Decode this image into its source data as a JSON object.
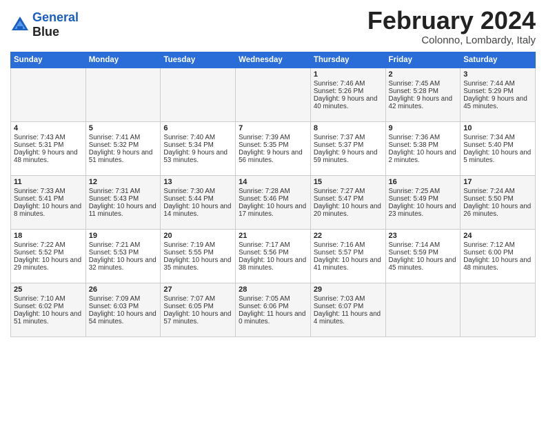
{
  "header": {
    "logo_line1": "General",
    "logo_line2": "Blue",
    "month": "February 2024",
    "location": "Colonno, Lombardy, Italy"
  },
  "weekdays": [
    "Sunday",
    "Monday",
    "Tuesday",
    "Wednesday",
    "Thursday",
    "Friday",
    "Saturday"
  ],
  "weeks": [
    [
      {
        "day": "",
        "sunrise": "",
        "sunset": "",
        "daylight": ""
      },
      {
        "day": "",
        "sunrise": "",
        "sunset": "",
        "daylight": ""
      },
      {
        "day": "",
        "sunrise": "",
        "sunset": "",
        "daylight": ""
      },
      {
        "day": "",
        "sunrise": "",
        "sunset": "",
        "daylight": ""
      },
      {
        "day": "1",
        "sunrise": "Sunrise: 7:46 AM",
        "sunset": "Sunset: 5:26 PM",
        "daylight": "Daylight: 9 hours and 40 minutes."
      },
      {
        "day": "2",
        "sunrise": "Sunrise: 7:45 AM",
        "sunset": "Sunset: 5:28 PM",
        "daylight": "Daylight: 9 hours and 42 minutes."
      },
      {
        "day": "3",
        "sunrise": "Sunrise: 7:44 AM",
        "sunset": "Sunset: 5:29 PM",
        "daylight": "Daylight: 9 hours and 45 minutes."
      }
    ],
    [
      {
        "day": "4",
        "sunrise": "Sunrise: 7:43 AM",
        "sunset": "Sunset: 5:31 PM",
        "daylight": "Daylight: 9 hours and 48 minutes."
      },
      {
        "day": "5",
        "sunrise": "Sunrise: 7:41 AM",
        "sunset": "Sunset: 5:32 PM",
        "daylight": "Daylight: 9 hours and 51 minutes."
      },
      {
        "day": "6",
        "sunrise": "Sunrise: 7:40 AM",
        "sunset": "Sunset: 5:34 PM",
        "daylight": "Daylight: 9 hours and 53 minutes."
      },
      {
        "day": "7",
        "sunrise": "Sunrise: 7:39 AM",
        "sunset": "Sunset: 5:35 PM",
        "daylight": "Daylight: 9 hours and 56 minutes."
      },
      {
        "day": "8",
        "sunrise": "Sunrise: 7:37 AM",
        "sunset": "Sunset: 5:37 PM",
        "daylight": "Daylight: 9 hours and 59 minutes."
      },
      {
        "day": "9",
        "sunrise": "Sunrise: 7:36 AM",
        "sunset": "Sunset: 5:38 PM",
        "daylight": "Daylight: 10 hours and 2 minutes."
      },
      {
        "day": "10",
        "sunrise": "Sunrise: 7:34 AM",
        "sunset": "Sunset: 5:40 PM",
        "daylight": "Daylight: 10 hours and 5 minutes."
      }
    ],
    [
      {
        "day": "11",
        "sunrise": "Sunrise: 7:33 AM",
        "sunset": "Sunset: 5:41 PM",
        "daylight": "Daylight: 10 hours and 8 minutes."
      },
      {
        "day": "12",
        "sunrise": "Sunrise: 7:31 AM",
        "sunset": "Sunset: 5:43 PM",
        "daylight": "Daylight: 10 hours and 11 minutes."
      },
      {
        "day": "13",
        "sunrise": "Sunrise: 7:30 AM",
        "sunset": "Sunset: 5:44 PM",
        "daylight": "Daylight: 10 hours and 14 minutes."
      },
      {
        "day": "14",
        "sunrise": "Sunrise: 7:28 AM",
        "sunset": "Sunset: 5:46 PM",
        "daylight": "Daylight: 10 hours and 17 minutes."
      },
      {
        "day": "15",
        "sunrise": "Sunrise: 7:27 AM",
        "sunset": "Sunset: 5:47 PM",
        "daylight": "Daylight: 10 hours and 20 minutes."
      },
      {
        "day": "16",
        "sunrise": "Sunrise: 7:25 AM",
        "sunset": "Sunset: 5:49 PM",
        "daylight": "Daylight: 10 hours and 23 minutes."
      },
      {
        "day": "17",
        "sunrise": "Sunrise: 7:24 AM",
        "sunset": "Sunset: 5:50 PM",
        "daylight": "Daylight: 10 hours and 26 minutes."
      }
    ],
    [
      {
        "day": "18",
        "sunrise": "Sunrise: 7:22 AM",
        "sunset": "Sunset: 5:52 PM",
        "daylight": "Daylight: 10 hours and 29 minutes."
      },
      {
        "day": "19",
        "sunrise": "Sunrise: 7:21 AM",
        "sunset": "Sunset: 5:53 PM",
        "daylight": "Daylight: 10 hours and 32 minutes."
      },
      {
        "day": "20",
        "sunrise": "Sunrise: 7:19 AM",
        "sunset": "Sunset: 5:55 PM",
        "daylight": "Daylight: 10 hours and 35 minutes."
      },
      {
        "day": "21",
        "sunrise": "Sunrise: 7:17 AM",
        "sunset": "Sunset: 5:56 PM",
        "daylight": "Daylight: 10 hours and 38 minutes."
      },
      {
        "day": "22",
        "sunrise": "Sunrise: 7:16 AM",
        "sunset": "Sunset: 5:57 PM",
        "daylight": "Daylight: 10 hours and 41 minutes."
      },
      {
        "day": "23",
        "sunrise": "Sunrise: 7:14 AM",
        "sunset": "Sunset: 5:59 PM",
        "daylight": "Daylight: 10 hours and 45 minutes."
      },
      {
        "day": "24",
        "sunrise": "Sunrise: 7:12 AM",
        "sunset": "Sunset: 6:00 PM",
        "daylight": "Daylight: 10 hours and 48 minutes."
      }
    ],
    [
      {
        "day": "25",
        "sunrise": "Sunrise: 7:10 AM",
        "sunset": "Sunset: 6:02 PM",
        "daylight": "Daylight: 10 hours and 51 minutes."
      },
      {
        "day": "26",
        "sunrise": "Sunrise: 7:09 AM",
        "sunset": "Sunset: 6:03 PM",
        "daylight": "Daylight: 10 hours and 54 minutes."
      },
      {
        "day": "27",
        "sunrise": "Sunrise: 7:07 AM",
        "sunset": "Sunset: 6:05 PM",
        "daylight": "Daylight: 10 hours and 57 minutes."
      },
      {
        "day": "28",
        "sunrise": "Sunrise: 7:05 AM",
        "sunset": "Sunset: 6:06 PM",
        "daylight": "Daylight: 11 hours and 0 minutes."
      },
      {
        "day": "29",
        "sunrise": "Sunrise: 7:03 AM",
        "sunset": "Sunset: 6:07 PM",
        "daylight": "Daylight: 11 hours and 4 minutes."
      },
      {
        "day": "",
        "sunrise": "",
        "sunset": "",
        "daylight": ""
      },
      {
        "day": "",
        "sunrise": "",
        "sunset": "",
        "daylight": ""
      }
    ]
  ]
}
